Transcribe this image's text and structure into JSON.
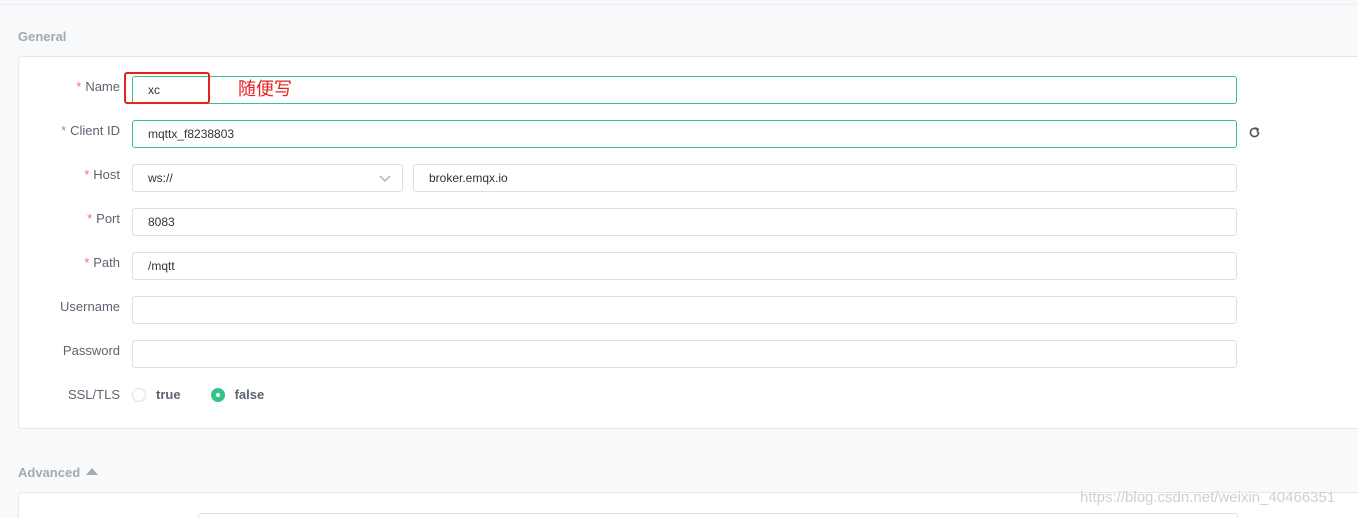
{
  "sections": {
    "general_title": "General",
    "advanced_title": "Advanced"
  },
  "form": {
    "name": {
      "label": "Name",
      "value": "xc",
      "required": true
    },
    "client_id": {
      "label": "Client ID",
      "value": "mqttx_f8238803",
      "required": true
    },
    "host": {
      "label": "Host",
      "protocol": "ws://",
      "value": "broker.emqx.io",
      "required": true
    },
    "port": {
      "label": "Port",
      "value": "8083",
      "required": true
    },
    "path": {
      "label": "Path",
      "value": "/mqtt",
      "required": true
    },
    "username": {
      "label": "Username",
      "value": ""
    },
    "password": {
      "label": "Password",
      "value": ""
    },
    "ssl_tls": {
      "label": "SSL/TLS",
      "options": [
        "true",
        "false"
      ],
      "selected": "false"
    }
  },
  "required_marker": "*",
  "annotation": {
    "text": "随便写",
    "color": "#e8201f"
  },
  "watermark": "https://blog.csdn.net/weixin_40466351",
  "icons": {
    "refresh": "refresh-icon",
    "dropdown": "chevron-down-icon",
    "collapse": "caret-up-icon"
  },
  "colors": {
    "accent": "#34c388",
    "required": "#f56c6c",
    "annotation": "#e8201f"
  }
}
